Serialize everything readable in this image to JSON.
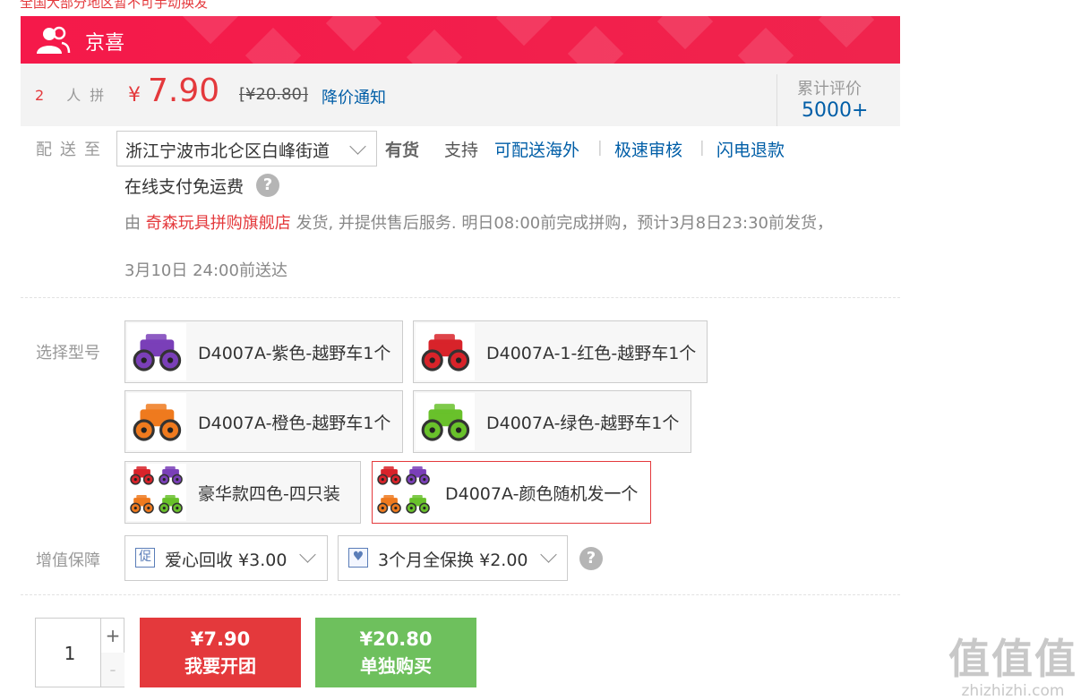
{
  "top_strip": "全国大部分地区暂不可手动换发",
  "banner": {
    "title": "京喜",
    "icon": "users-icon"
  },
  "price": {
    "group_num": "2",
    "group_suffix": "人拼",
    "yen": "¥",
    "current": "7.90",
    "original": "[¥20.80]",
    "notify": "降价通知",
    "review_label": "累计评价",
    "review_count": "5000+"
  },
  "delivery": {
    "label": "配送至",
    "address": "浙江宁波市北仑区白峰街道",
    "stock": "有货",
    "support": "支持",
    "services": [
      "可配送海外",
      "极速审核",
      "闪电退款"
    ],
    "separator": "|",
    "free_shipping": "在线支付免运费",
    "ship_prefix": "由",
    "store": "奇森玩具拼购旗舰店",
    "ship_info": "发货, 并提供售后服务. 明日08:00前完成拼购，预计3月8日23:30前发货，",
    "ship_info2": "3月10日 24:00前送达"
  },
  "options": {
    "label": "选择型号",
    "items": [
      {
        "label": "D4007A-紫色-越野车1个",
        "color": "#7a3fb8"
      },
      {
        "label": "D4007A-1-红色-越野车1个",
        "color": "#d8232a"
      },
      {
        "label": "D4007A-橙色-越野车1个",
        "color": "#ef7a1e"
      },
      {
        "label": "D4007A-绿色-越野车1个",
        "color": "#69c12b"
      },
      {
        "label": "豪华款四色-四只装",
        "color": "#7a3fb8"
      },
      {
        "label": "D4007A-颜色随机发一个",
        "color": "#d8232a"
      }
    ],
    "selected_index": 5
  },
  "value_added": {
    "label": "增值保障",
    "items": [
      {
        "icon": "促",
        "text": "爱心回收 ¥3.00"
      },
      {
        "icon": "♥",
        "text": "3个月全保换 ¥2.00"
      }
    ]
  },
  "purchase": {
    "quantity": "1",
    "plus": "+",
    "minus": "-",
    "group_price": "¥7.90",
    "group_label": "我要开团",
    "solo_price": "¥20.80",
    "solo_label": "单独购买"
  },
  "watermark": {
    "logo": "值值值",
    "url": "zhizhizhi.com"
  },
  "colors": {
    "brand_red": "#e4393c",
    "link_blue": "#005ea7",
    "green": "#6ec05d",
    "banner": "#f5194a"
  }
}
